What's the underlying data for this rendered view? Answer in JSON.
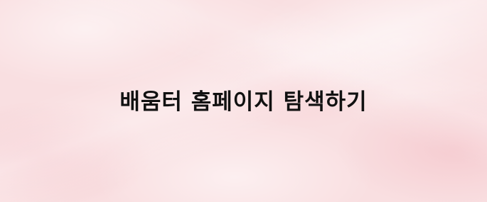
{
  "banner": {
    "title": "배움터 홈페이지 탐색하기",
    "text_color": "#111111",
    "background_color": "#f9dfe1"
  }
}
